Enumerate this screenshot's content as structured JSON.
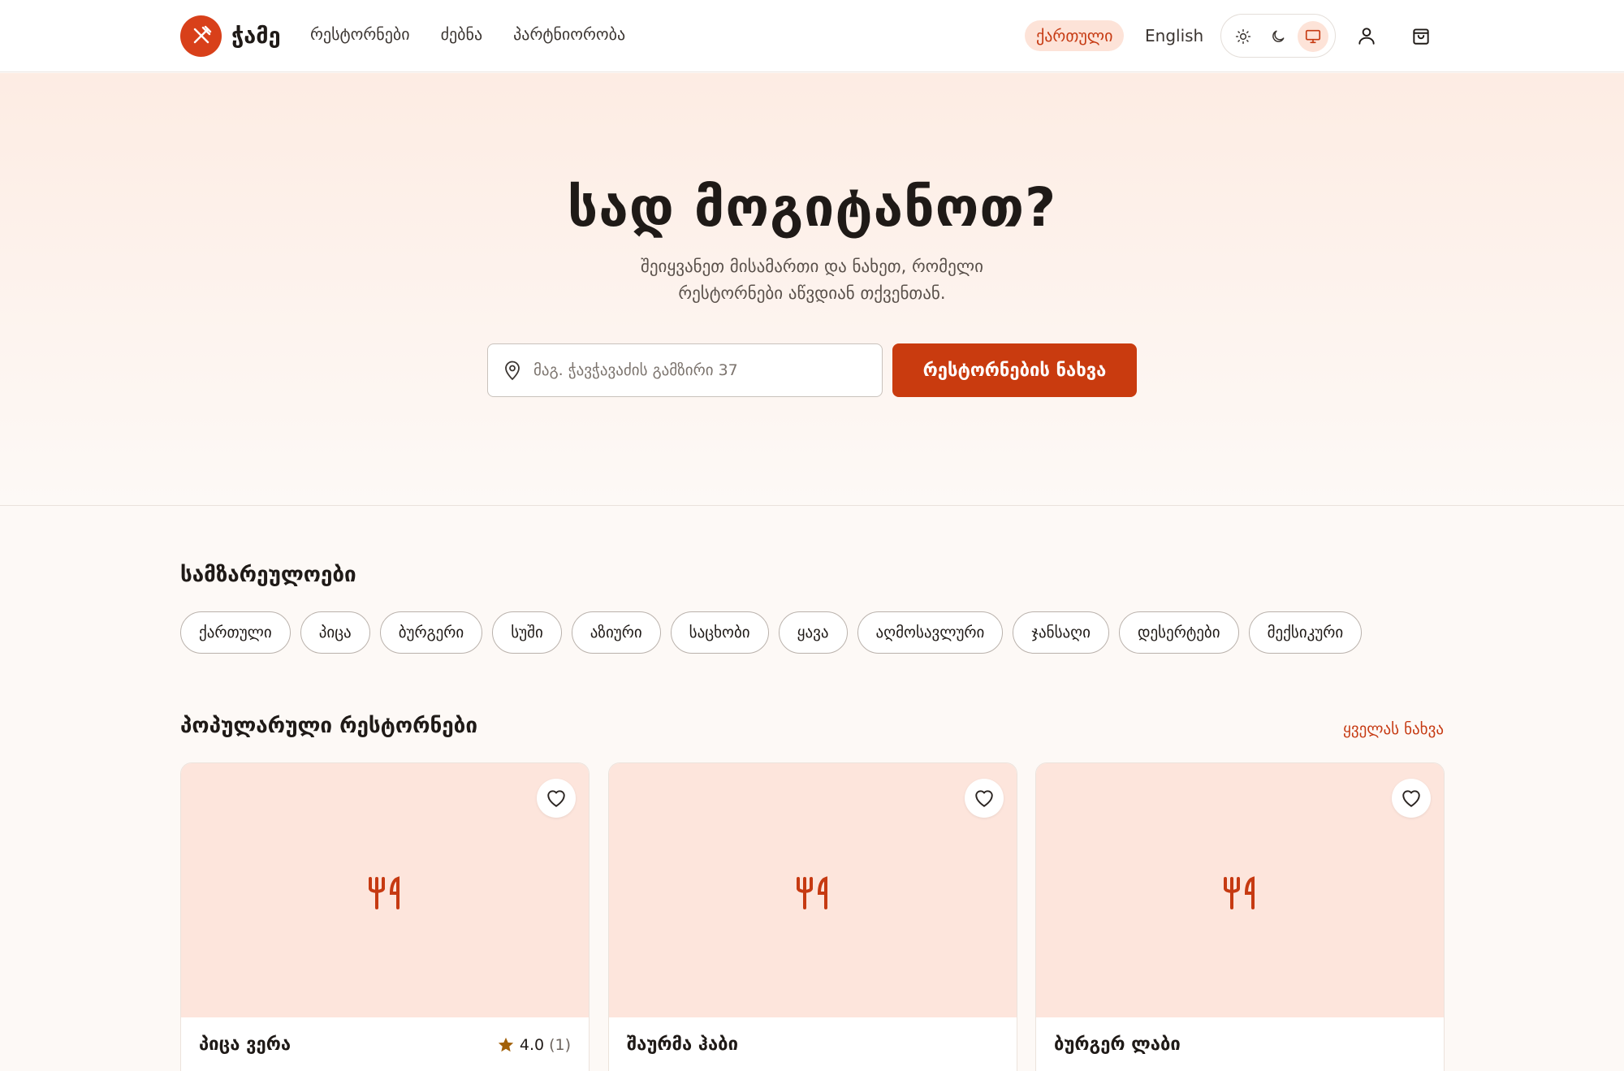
{
  "header": {
    "logo_text": "ჭამე",
    "nav": [
      "რესტორნები",
      "ძებნა",
      "პარტნიორობა"
    ],
    "lang_active": "ქართული",
    "lang_other": "English",
    "theme_modes": [
      "light",
      "dark",
      "system"
    ],
    "theme_selected": "system"
  },
  "hero": {
    "title": "სად მოგიტანოთ?",
    "subtitle_line1": "შეიყვანეთ მისამართი და ნახეთ, რომელი",
    "subtitle_line2": "რესტორნები აწვდიან თქვენთან.",
    "search_placeholder": "მაგ. ჭავჭავაძის გამზირი 37",
    "cta_label": "რესტორნების ნახვა"
  },
  "cuisines": {
    "title": "სამზარეულოები",
    "items": [
      "ქართული",
      "პიცა",
      "ბურგერი",
      "სუში",
      "აზიური",
      "საცხობი",
      "ყავა",
      "აღმოსავლური",
      "ჯანსაღი",
      "დესერტები",
      "მექსიკური"
    ]
  },
  "popular": {
    "title": "პოპულარული რესტორნები",
    "see_all": "ყველას ნახვა",
    "restaurants": [
      {
        "name": "პიცა ვერა",
        "rating": "4.0",
        "count": "(1)"
      },
      {
        "name": "შაურმა ჰაბი",
        "rating": "",
        "count": ""
      },
      {
        "name": "ბურგერ ლაბი",
        "rating": "",
        "count": ""
      }
    ]
  },
  "colors": {
    "accent": "#c93b0f",
    "accent_soft": "#fde3d8",
    "card_image_bg": "#fde5dc",
    "star": "#a2610a"
  }
}
